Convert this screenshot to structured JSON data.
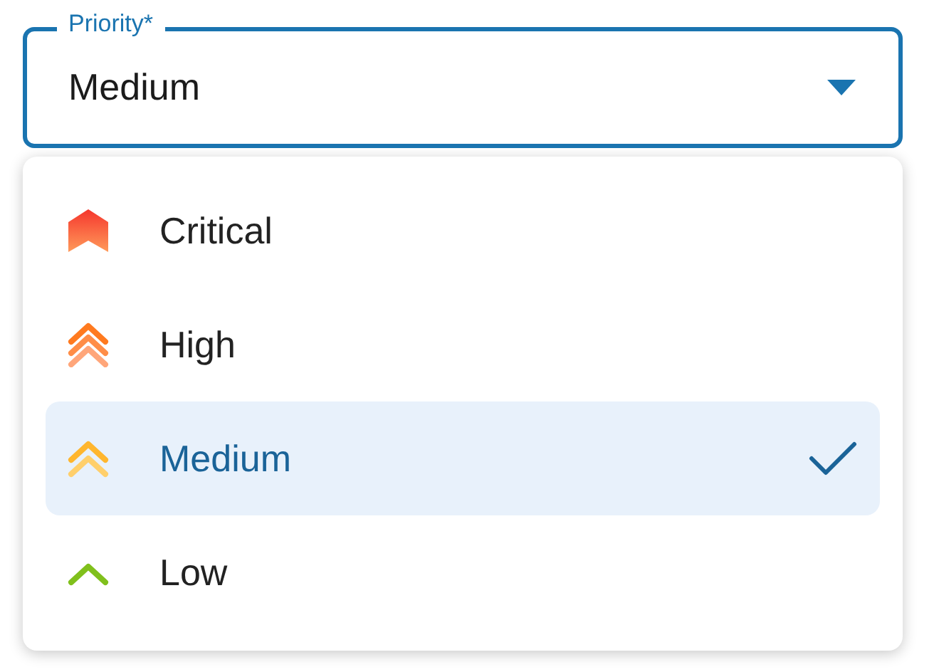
{
  "field": {
    "label": "Priority*",
    "value": "Medium",
    "expanded": true
  },
  "options": [
    {
      "label": "Critical",
      "kind": "critical",
      "selected": false
    },
    {
      "label": "High",
      "kind": "high",
      "selected": false
    },
    {
      "label": "Medium",
      "kind": "medium",
      "selected": true
    },
    {
      "label": "Low",
      "kind": "low",
      "selected": false
    }
  ]
}
